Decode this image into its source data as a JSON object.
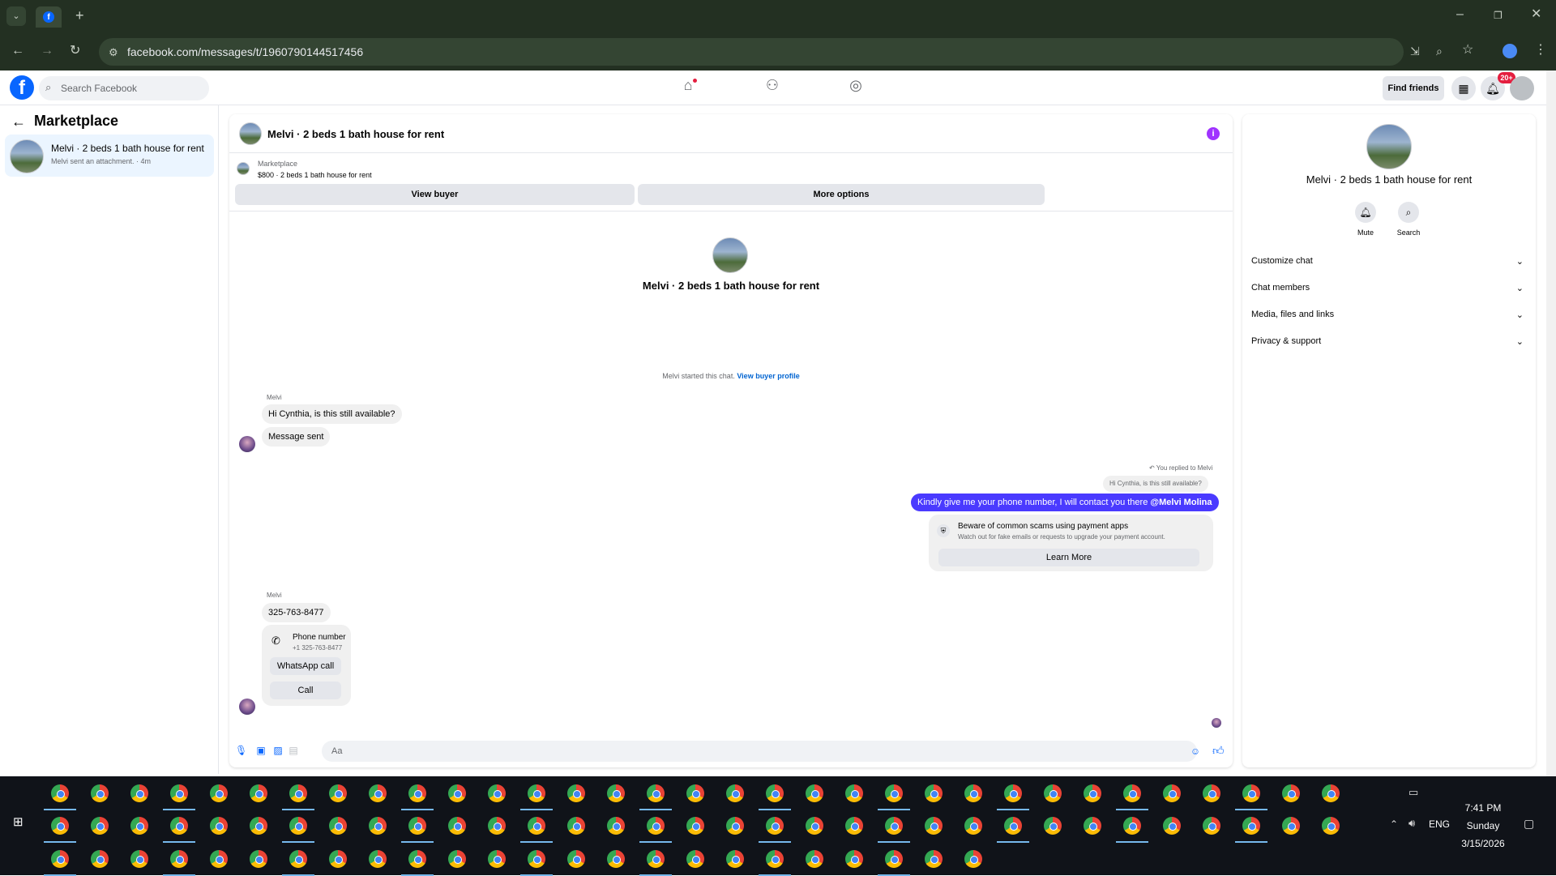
{
  "browser": {
    "url": "facebook.com/messages/t/1960790144517456",
    "tab_favicon": "facebook-icon"
  },
  "fb_header": {
    "search_placeholder": "Search Facebook",
    "find_friends": "Find friends",
    "notification_badge": "20+"
  },
  "sidebar": {
    "title": "Marketplace",
    "conversation": {
      "name": "Melvi · 2 beds 1 bath house for rent",
      "preview": "Melvi sent an attachment. · 4m"
    }
  },
  "chat": {
    "title": "Melvi · 2 beds 1 bath house for rent",
    "marketplace_label": "Marketplace",
    "listing": "$800 · 2 beds 1 bath house for rent",
    "view_buyer": "View buyer",
    "more_options": "More options",
    "header_name": "Melvi · 2 beds 1 bath house for rent",
    "started_text": "Melvi started this chat.",
    "view_buyer_profile": "View buyer profile",
    "messages": {
      "sender1": "Melvi",
      "msg1": "Hi Cynthia, is this still available?",
      "msg2": "Message sent",
      "replied_label": "You replied to Melvi",
      "quoted": "Hi Cynthia, is this still available?",
      "outgoing": "Kindly give me your phone number, I will contact you there",
      "mention": "@Melvi Molina",
      "scam_title": "Beware of common scams using payment apps",
      "scam_sub": "Watch out for fake emails or requests to upgrade your payment account.",
      "learn_more": "Learn More",
      "sender2": "Melvi",
      "phone_msg": "325-763-8477",
      "phone_card_title": "Phone number",
      "phone_card_number": "+1 325-763-8477",
      "whatsapp_call": "WhatsApp call",
      "call": "Call"
    },
    "composer_placeholder": "Aa"
  },
  "right_panel": {
    "name": "Melvi · 2 beds 1 bath house for rent",
    "mute": "Mute",
    "search": "Search",
    "sections": [
      "Customize chat",
      "Chat members",
      "Media, files and links",
      "Privacy & support"
    ]
  },
  "taskbar": {
    "time": "7:41 PM",
    "day": "Sunday",
    "date": "3/15/2026",
    "lang": "ENG"
  }
}
